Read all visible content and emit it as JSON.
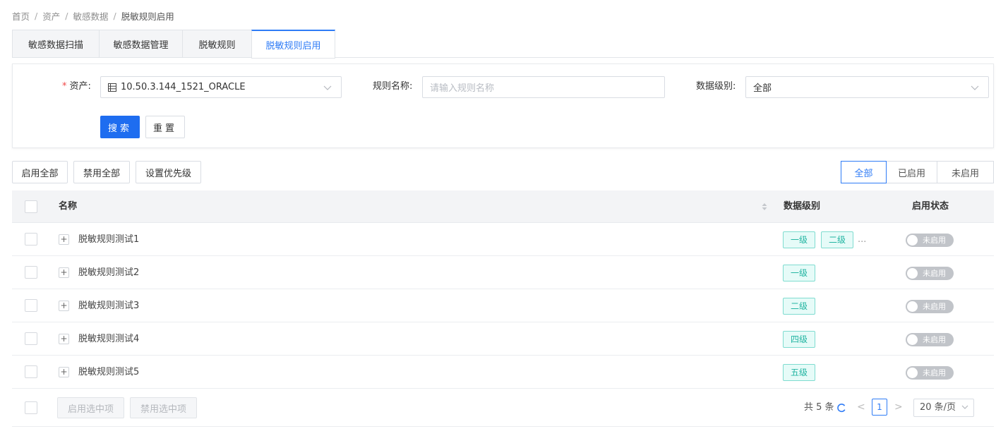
{
  "breadcrumb": {
    "items": [
      "首页",
      "资产",
      "敏感数据",
      "脱敏规则启用"
    ],
    "separator": "/"
  },
  "tabs": [
    {
      "label": "敏感数据扫描"
    },
    {
      "label": "敏感数据管理"
    },
    {
      "label": "脱敏规则"
    },
    {
      "label": "脱敏规则启用",
      "active": true
    }
  ],
  "filters": {
    "asset_required_mark": "*",
    "asset_label": "资产:",
    "asset_value": "10.50.3.144_1521_ORACLE",
    "asset_icon": "database-icon",
    "rule_name_label": "规则名称:",
    "rule_name_placeholder": "请输入规则名称",
    "level_label": "数据级别:",
    "level_value": "全部",
    "search_label": "搜索",
    "reset_label": "重置"
  },
  "toolbar": {
    "enable_all": "启用全部",
    "disable_all": "禁用全部",
    "set_priority": "设置优先级"
  },
  "status_filter": {
    "options": [
      "全部",
      "已启用",
      "未启用"
    ],
    "selected": "全部"
  },
  "table": {
    "columns": {
      "name": "名称",
      "level": "数据级别",
      "status": "启用状态"
    },
    "rows": [
      {
        "name": "脱敏规则测试1",
        "levels": [
          "一级",
          "二级"
        ],
        "more": "...",
        "status": "未启用"
      },
      {
        "name": "脱敏规则测试2",
        "levels": [
          "一级"
        ],
        "status": "未启用"
      },
      {
        "name": "脱敏规则测试3",
        "levels": [
          "二级"
        ],
        "status": "未启用"
      },
      {
        "name": "脱敏规则测试4",
        "levels": [
          "四级"
        ],
        "status": "未启用"
      },
      {
        "name": "脱敏规则测试5",
        "levels": [
          "五级"
        ],
        "status": "未启用"
      }
    ],
    "expand_symbol": "+"
  },
  "footer": {
    "enable_selected": "启用选中项",
    "disable_selected": "禁用选中项",
    "total": "共 5 条",
    "prev": "<",
    "page": "1",
    "next": ">",
    "page_size": "20 条/页"
  },
  "colors": {
    "primary": "#1e6df0",
    "accent": "#2f7cf6",
    "tag_text": "#23b5a2",
    "tag_bg": "#e6fbf8",
    "switch_off": "#c1c4c9",
    "required": "#f04848"
  }
}
